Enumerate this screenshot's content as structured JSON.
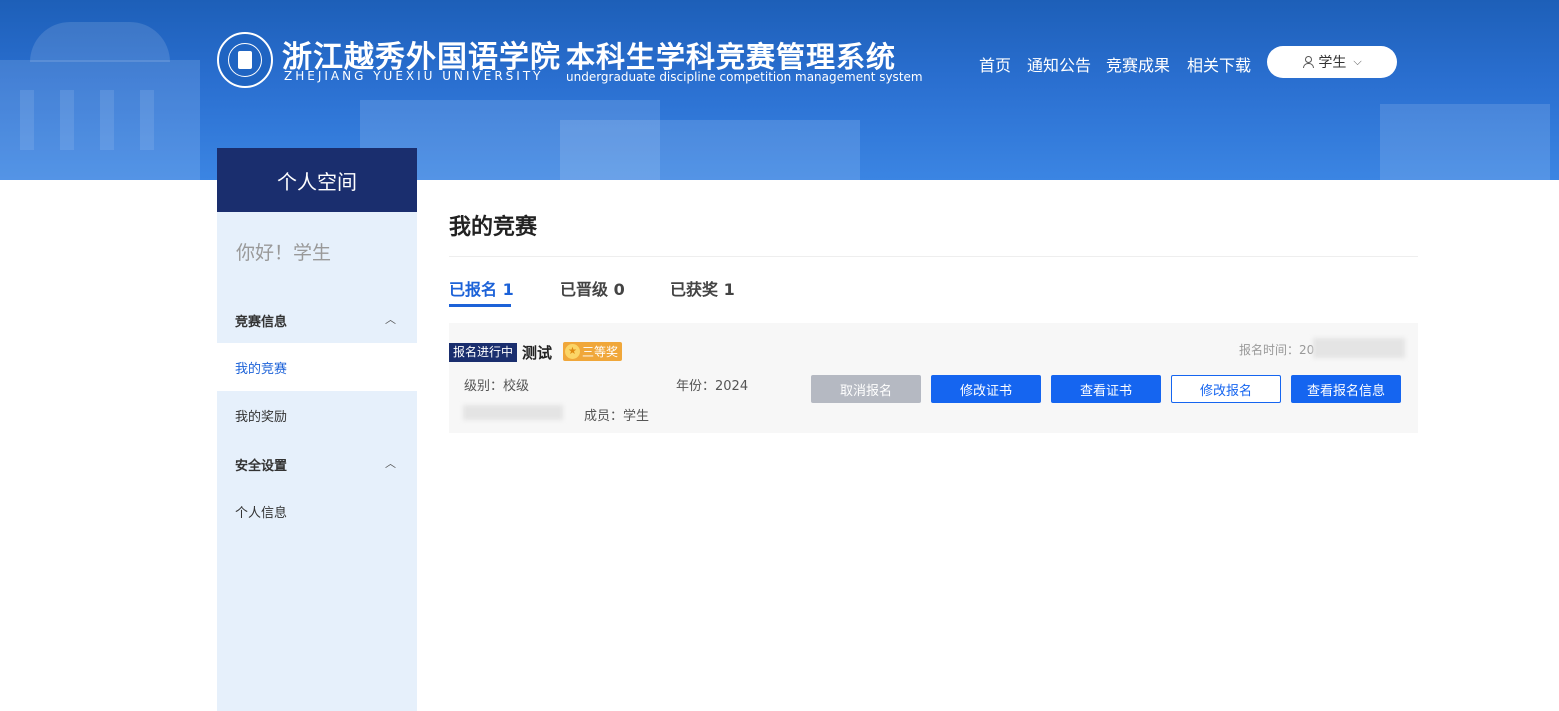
{
  "header": {
    "school_cn": "浙江越秀外国语学院",
    "school_en": "ZHEJIANG   YUEXIU   UNIVERSITY",
    "system_cn": "本科生学科竞赛管理系统",
    "system_en": "undergraduate discipline competition management system",
    "nav": [
      "首页",
      "通知公告",
      "竞赛成果",
      "相关下载"
    ],
    "user": "学生"
  },
  "sidebar": {
    "title": "个人空间",
    "greeting": "你好！学生",
    "groups": [
      {
        "label": "竞赛信息",
        "items": [
          "我的竞赛",
          "我的奖励"
        ]
      },
      {
        "label": "安全设置",
        "items": [
          "个人信息"
        ]
      }
    ],
    "active_item": "我的竞赛"
  },
  "main": {
    "title": "我的竞赛",
    "tabs": [
      "已报名 1",
      "已晋级 0",
      "已获奖 1"
    ],
    "active_tab": 0,
    "card": {
      "status": "报名进行中",
      "name": "测试",
      "award": "三等奖",
      "reg_time_label": "报名时间：20",
      "level": "级别：校级",
      "year": "年份：2024",
      "members": "成员：学生",
      "buttons": [
        "取消报名",
        "修改证书",
        "查看证书",
        "修改报名",
        "查看报名信息"
      ]
    }
  },
  "icons": [
    "user-icon",
    "chevron-down-icon",
    "chevron-up-icon",
    "star-icon",
    "school-logo"
  ],
  "colors": {
    "primary": "#1565f0",
    "navy": "#1a2e6e",
    "sidebar_bg": "#e6f0fb",
    "award": "#f0a73a"
  }
}
